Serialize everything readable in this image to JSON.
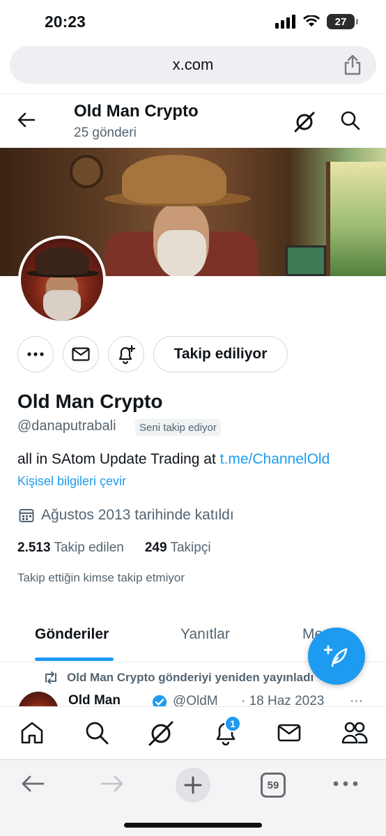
{
  "status_bar": {
    "time": "20:23",
    "battery": "27"
  },
  "browser": {
    "url": "x.com",
    "tab_count": "59"
  },
  "header": {
    "title": "Old Man Crypto",
    "subtitle": "25 gönderi"
  },
  "profile": {
    "name": "Old Man Crypto",
    "handle": "@danaputrabali",
    "follows_you": "Seni takip ediyor",
    "follow_button": "Takip ediliyor",
    "bio_text": "all in SAtom Update Trading at ",
    "bio_link": "t.me/ChannelOld",
    "translate": "Kişisel bilgileri çevir",
    "joined": "Ağustos 2013 tarihinde katıldı",
    "following_count": "2.513",
    "following_label": "Takip edilen",
    "followers_count": "249",
    "followers_label": "Takipçi",
    "mutuals": "Takip ettiğin kimse takip etmiyor"
  },
  "tabs": [
    {
      "label": "Gönderiler",
      "active": true
    },
    {
      "label": "Yanıtlar",
      "active": false
    },
    {
      "label": "Me",
      "active": false
    }
  ],
  "tweet": {
    "repost_text": "Old Man Crypto gönderiyi yeniden yayınladı",
    "author": "Old Man",
    "handle": "@OldM",
    "date": "· 18 Haz 2023",
    "more": "···"
  },
  "app_nav": {
    "notification_count": "1"
  },
  "colors": {
    "accent": "#1d9bf0",
    "text": "#0f1419",
    "muted": "#536471"
  }
}
